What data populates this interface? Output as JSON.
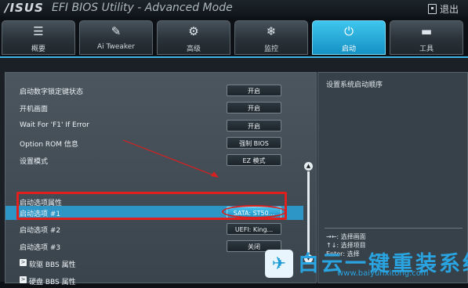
{
  "titlebar": {
    "brand": "/ISUS",
    "title": "EFI BIOS Utility - Advanced Mode",
    "exit_label": "退出"
  },
  "tabs": [
    {
      "label": "概要",
      "icon": "list-icon"
    },
    {
      "label": "Ai Tweaker",
      "icon": "tweaker-icon"
    },
    {
      "label": "高级",
      "icon": "advanced-icon"
    },
    {
      "label": "监控",
      "icon": "monitor-icon"
    },
    {
      "label": "启动",
      "icon": "power-icon",
      "active": true
    },
    {
      "label": "工具",
      "icon": "toolbox-icon"
    }
  ],
  "settings": [
    {
      "label": "启动数字锁定键状态",
      "value": "开启"
    },
    {
      "label": "开机画面",
      "value": "开启"
    },
    {
      "label": "Wait For 'F1' If Error",
      "value": "开启"
    },
    {
      "label": "Option ROM 信息",
      "value": "强制 BIOS"
    },
    {
      "label": "设置模式",
      "value": "EZ 模式"
    }
  ],
  "boot_section_label": "启动选项属性",
  "boot_options": [
    {
      "label": "启动选项 #1",
      "value": "SATA: ST50...",
      "selected": true
    },
    {
      "label": "启动选项 #2",
      "value": "UEFI: King..."
    },
    {
      "label": "启动选项 #3",
      "value": "关闭"
    }
  ],
  "submenus": [
    {
      "label": "软驱 BBS 属性"
    },
    {
      "label": "硬盘 BBS 属性"
    }
  ],
  "help": {
    "description": "设置系统启动顺序",
    "keys": [
      "→←: 选择画面",
      "↑↓: 选择项目",
      "Enter: 选择"
    ]
  },
  "watermark": {
    "title": "白云一键重装系统",
    "url": "www.baiyunxitong.com"
  },
  "colors": {
    "accent": "#3eb5e4",
    "highlight": "#2d96c6",
    "annotation_red": "#e0201f"
  }
}
